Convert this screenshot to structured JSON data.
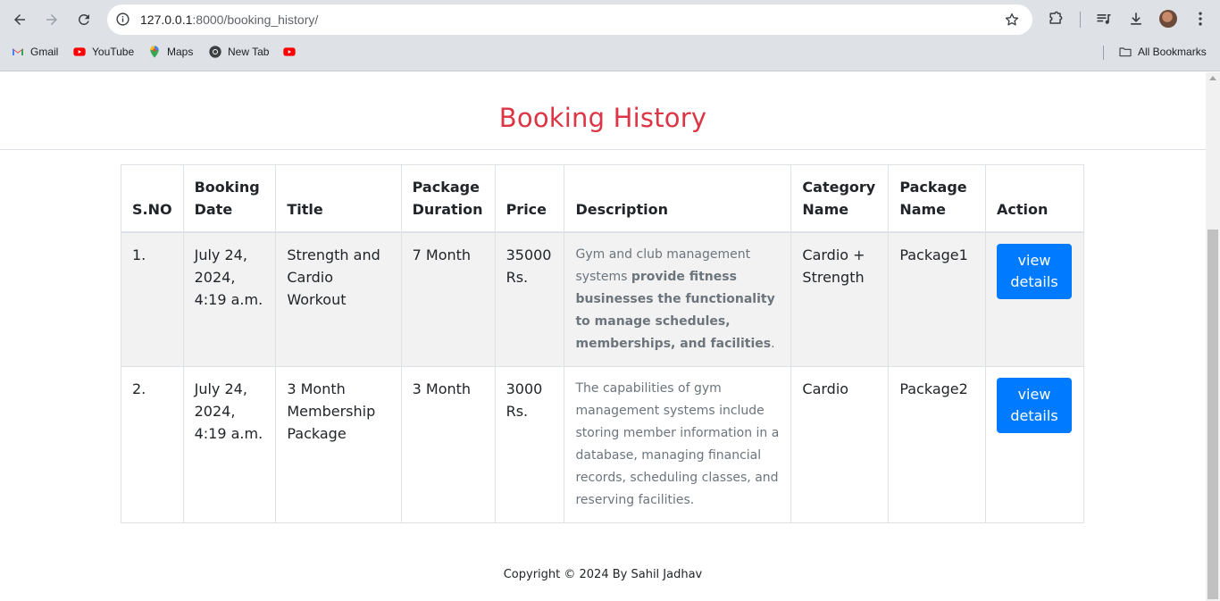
{
  "browser": {
    "url_host": "127.0.0.1",
    "url_rest": ":8000/booking_history/",
    "bookmarks": [
      {
        "label": "Gmail",
        "icon": "gmail-icon"
      },
      {
        "label": "YouTube",
        "icon": "youtube-icon"
      },
      {
        "label": "Maps",
        "icon": "maps-icon"
      },
      {
        "label": "New Tab",
        "icon": "chrome-icon"
      },
      {
        "label": "",
        "icon": "youtube-icon"
      }
    ],
    "all_bookmarks": "All Bookmarks"
  },
  "page": {
    "title": "Booking History",
    "title_color": "#dc3545",
    "table": {
      "headers": [
        {
          "line1": "",
          "line2": "S.NO"
        },
        {
          "line1": "Booking",
          "line2": "Date"
        },
        {
          "line1": "",
          "line2": "Title"
        },
        {
          "line1": "Package",
          "line2": "Duration"
        },
        {
          "line1": "",
          "line2": "Price"
        },
        {
          "line1": "",
          "line2": "Description"
        },
        {
          "line1": "Category",
          "line2": "Name"
        },
        {
          "line1": "Package",
          "line2": "Name"
        },
        {
          "line1": "",
          "line2": "Action"
        }
      ],
      "rows": [
        {
          "sno": "1.",
          "date": "July 24, 2024, 4:19 a.m.",
          "title": "Strength and Cardio Workout",
          "duration": "7 Month",
          "price": "35000 Rs.",
          "desc_plain": "Gym and club management systems ",
          "desc_bold": "provide fitness businesses the functionality to manage schedules, memberships, and facilities",
          "desc_tail": ".",
          "category": "Cardio + Strength",
          "package": "Package1",
          "action": "view details"
        },
        {
          "sno": "2.",
          "date": "July 24, 2024, 4:19 a.m.",
          "title": "3 Month Membership Package",
          "duration": "3 Month",
          "price": "3000 Rs.",
          "desc_plain": "The capabilities of gym management systems include storing member information in a database, managing financial records, scheduling classes, and reserving facilities.",
          "desc_bold": "",
          "desc_tail": "",
          "category": "Cardio",
          "package": "Package2",
          "action": "view details"
        }
      ]
    },
    "button_color": "#007bff",
    "footer": "Copyright © 2024 By Sahil Jadhav"
  }
}
